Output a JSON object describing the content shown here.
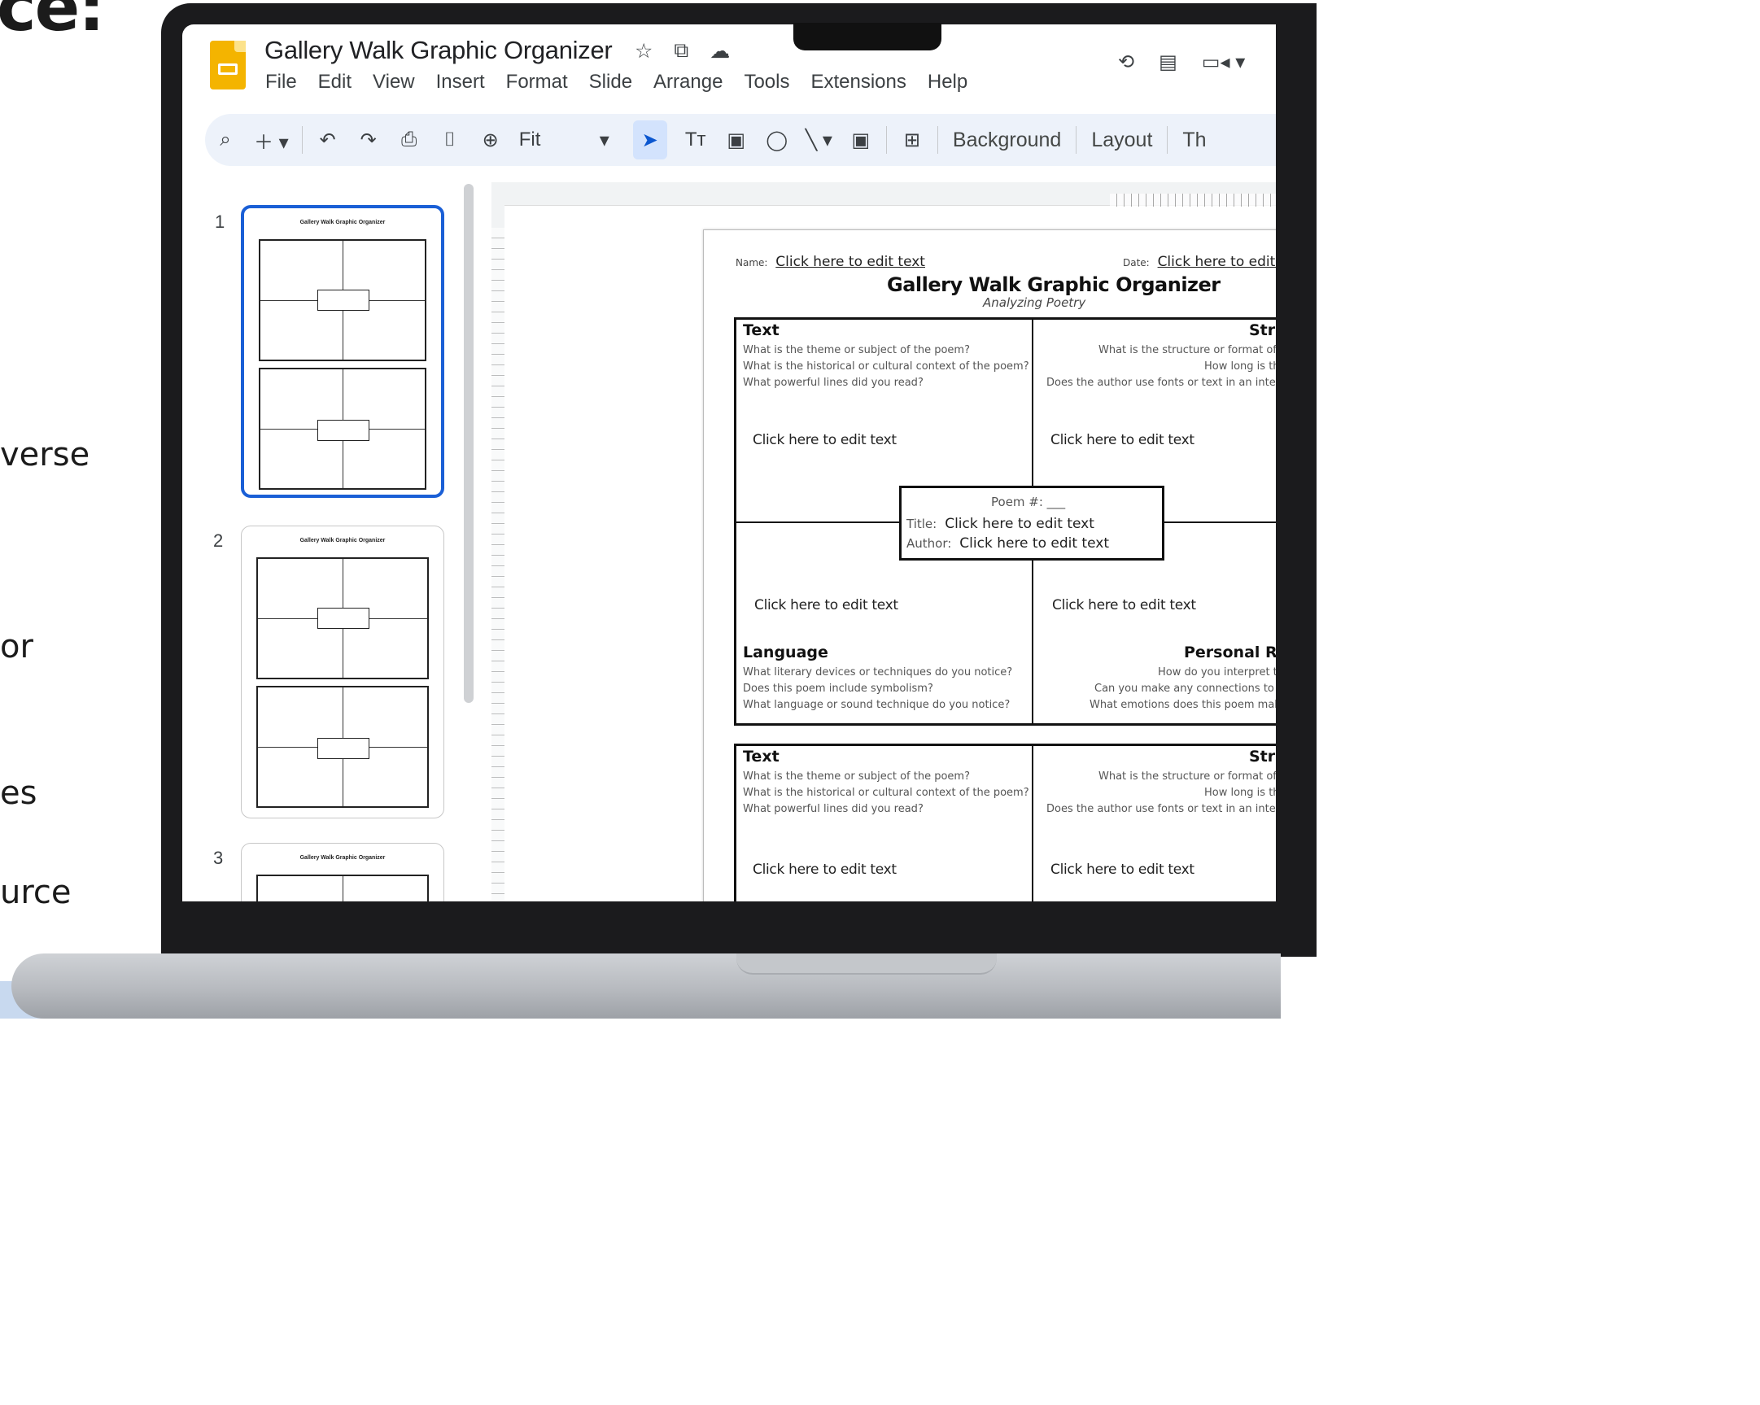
{
  "marketing": {
    "hero": "ce:",
    "lines": [
      "verse",
      "or",
      "es",
      "urce"
    ]
  },
  "app": {
    "doc_title": "Gallery Walk Graphic Organizer",
    "menu": [
      "File",
      "Edit",
      "View",
      "Insert",
      "Format",
      "Slide",
      "Arrange",
      "Tools",
      "Extensions",
      "Help"
    ],
    "zoom": "Fit",
    "toolbar_buttons": {
      "background": "Background",
      "layout": "Layout",
      "theme": "Th"
    }
  },
  "filmstrip": {
    "slides": [
      {
        "num": "1",
        "thumb_title": "Gallery Walk Graphic Organizer"
      },
      {
        "num": "2",
        "thumb_title": "Gallery Walk Graphic Organizer"
      },
      {
        "num": "3",
        "thumb_title": "Gallery Walk Graphic Organizer"
      }
    ]
  },
  "slide": {
    "name_label": "Name:",
    "name_value": "Click here to edit text",
    "date_label": "Date:",
    "date_value": "Click here to edit te",
    "title": "Gallery Walk Graphic Organizer",
    "subtitle": "Analyzing Poetry",
    "grids": [
      {
        "text_head": "Text",
        "text_q": [
          "What is the theme or subject of the poem?",
          "What is the historical or cultural context of the poem?",
          "What powerful lines did you read?"
        ],
        "structure_head": "Stru",
        "structure_q": [
          "What is the structure or format of the",
          "How long is the",
          "Does the author use fonts or text in an interesti"
        ],
        "click_tl": "Click here to edit text",
        "click_tr": "Click here to edit text",
        "click_bl": "Click here to edit text",
        "click_br": "Click here to edit text",
        "poem_num": "Poem #: ___",
        "title_label": "Title:",
        "title_value": "Click here to edit text",
        "author_label": "Author:",
        "author_value": "Click here to edit text",
        "language_head": "Language",
        "language_q": [
          "What literary devices or techniques do you notice?",
          "Does this poem include symbolism?",
          "What language or sound technique do you notice?"
        ],
        "personal_head": "Personal Resp",
        "personal_q": [
          "How do you interpret thi",
          "Can you make any connections to thi",
          "What emotions does this poem make y"
        ]
      },
      {
        "text_head": "Text",
        "text_q": [
          "What is the theme or subject of the poem?",
          "What is the historical or cultural context of the poem?",
          "What powerful lines did you read?"
        ],
        "structure_head": "Stru",
        "structure_q": [
          "What is the structure or format of the",
          "How long is the",
          "Does the author use fonts or text in an interesti"
        ],
        "click_tl": "Click here to edit text",
        "click_tr": "Click here to edit text"
      }
    ]
  }
}
